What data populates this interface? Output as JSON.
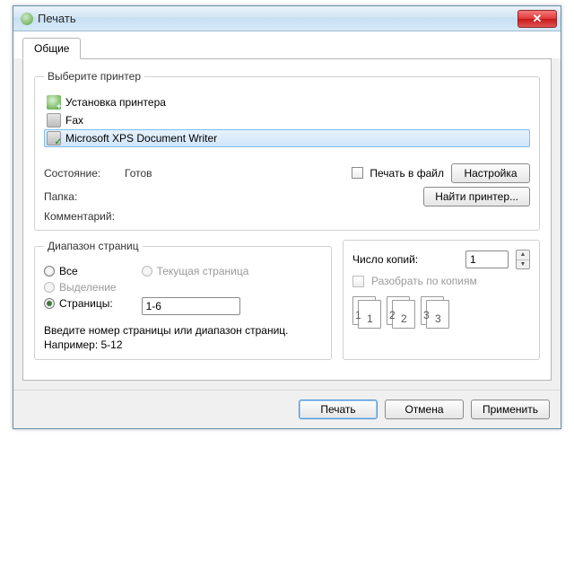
{
  "window": {
    "title": "Печать"
  },
  "tabs": {
    "general": "Общие"
  },
  "printerbox": {
    "legend": "Выберите принтер",
    "items": [
      {
        "label": "Установка принтера",
        "selected": false,
        "icon": "add"
      },
      {
        "label": "Fax",
        "selected": false,
        "icon": "fax"
      },
      {
        "label": "Microsoft XPS Document Writer",
        "selected": true,
        "icon": "xps"
      }
    ],
    "status_label": "Состояние:",
    "status_value": "Готов",
    "folder_label": "Папка:",
    "folder_value": "",
    "comment_label": "Комментарий:",
    "comment_value": "",
    "print_to_file": "Печать в файл",
    "btn_prefs": "Настройка",
    "btn_find": "Найти принтер..."
  },
  "range": {
    "legend": "Диапазон страниц",
    "all": "Все",
    "current": "Текущая страница",
    "selection": "Выделение",
    "pages": "Страницы:",
    "pages_value": "1-6",
    "help": "Введите номер страницы или диапазон страниц.   Например: 5-12"
  },
  "copies": {
    "legend": "",
    "count_label": "Число копий:",
    "count_value": "1",
    "collate": "Разобрать по копиям"
  },
  "buttons": {
    "print": "Печать",
    "cancel": "Отмена",
    "apply": "Применить"
  }
}
